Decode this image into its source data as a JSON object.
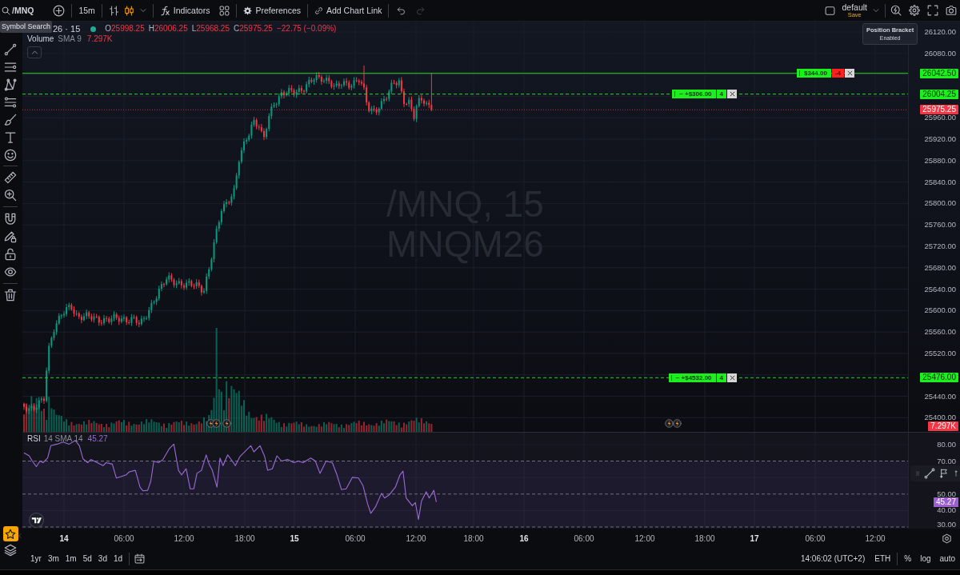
{
  "toolbar": {
    "symbol": "/MNQ",
    "interval": "15m",
    "buttons": [
      {
        "kind": "indicators",
        "label": "Indicators"
      },
      {
        "kind": "preferences",
        "label": "Preferences"
      },
      {
        "kind": "link",
        "label": "Add Chart Link"
      }
    ],
    "history": [
      {
        "kind": "undo",
        "disabled": false
      },
      {
        "kind": "redo",
        "disabled": true
      }
    ],
    "layout": {
      "name": "default",
      "action": "Save"
    }
  },
  "tooltips": [
    {
      "kind": "simple",
      "text": "Symbol Search"
    },
    {
      "kind": "status",
      "title": "Position Bracket",
      "status": "Enabled"
    }
  ],
  "left_toolbar": {
    "favorites_active": true
  },
  "legend": {
    "symbol": "26 · 15",
    "market_open": true,
    "ohlc": [
      {
        "key": "O",
        "value": "25998.25"
      },
      {
        "key": "H",
        "value": "26006.25"
      },
      {
        "key": "L",
        "value": "25968.25"
      },
      {
        "key": "C",
        "value": "25975.25"
      }
    ],
    "change": "−22.75 (−0.09%)",
    "falling": true,
    "indicators": [
      {
        "name": "Volume",
        "params": "SMA 9",
        "value": "7.297K"
      }
    ]
  },
  "background_label": [
    "/MNQ, 15",
    "MNQM26"
  ],
  "order_lines": [
    {
      "kind": "position",
      "pnl": "$344.00",
      "quantity": "-4",
      "short": true,
      "price": "26042.50"
    },
    {
      "kind": "order",
      "pnl": "~ +$306.00",
      "quantity": "4",
      "short": false,
      "price": "26004.25"
    },
    {
      "kind": "order",
      "pnl": "~ +$4532.00",
      "quantity": "4",
      "short": false,
      "price": "25476.00"
    }
  ],
  "price_axis": {
    "ticks": [
      "26120.00",
      "26080.00",
      "25960.00",
      "25920.00",
      "25880.00",
      "25840.00",
      "25800.00",
      "25760.00",
      "25720.00",
      "25680.00",
      "25640.00",
      "25600.00",
      "25560.00",
      "25520.00",
      "25440.00",
      "25400.00"
    ],
    "markers": [
      {
        "kind": "last_price",
        "text": "25975.25"
      },
      {
        "kind": "volume",
        "text": "7.297K"
      }
    ]
  },
  "rsi_pane": {
    "legend": {
      "name": "RSI",
      "params": "14 SMA 14",
      "value": "45.27"
    },
    "ticks": [
      "80.00",
      "70.00",
      "50.00",
      "40.00",
      "30.00"
    ],
    "marker": "45.27"
  },
  "time_axis": [
    {
      "kind": "day",
      "text": "14"
    },
    {
      "kind": "time",
      "text": "06:00"
    },
    {
      "kind": "time",
      "text": "12:00"
    },
    {
      "kind": "time",
      "text": "18:00"
    },
    {
      "kind": "day",
      "text": "15"
    },
    {
      "kind": "time",
      "text": "06:00"
    },
    {
      "kind": "time",
      "text": "12:00"
    },
    {
      "kind": "time",
      "text": "18:00"
    },
    {
      "kind": "day",
      "text": "16"
    },
    {
      "kind": "time",
      "text": "06:00"
    },
    {
      "kind": "time",
      "text": "12:00"
    },
    {
      "kind": "time",
      "text": "18:00"
    },
    {
      "kind": "day",
      "text": "17"
    },
    {
      "kind": "time",
      "text": "06:00"
    },
    {
      "kind": "time",
      "text": "12:00"
    }
  ],
  "bottom_bar": {
    "ranges": [
      "1yr",
      "3m",
      "1m",
      "5d",
      "3d",
      "1d"
    ],
    "clock": "14:06:02 (UTC+2)",
    "session": "ETH",
    "scale_options": [
      "%",
      "log",
      "auto"
    ]
  }
}
